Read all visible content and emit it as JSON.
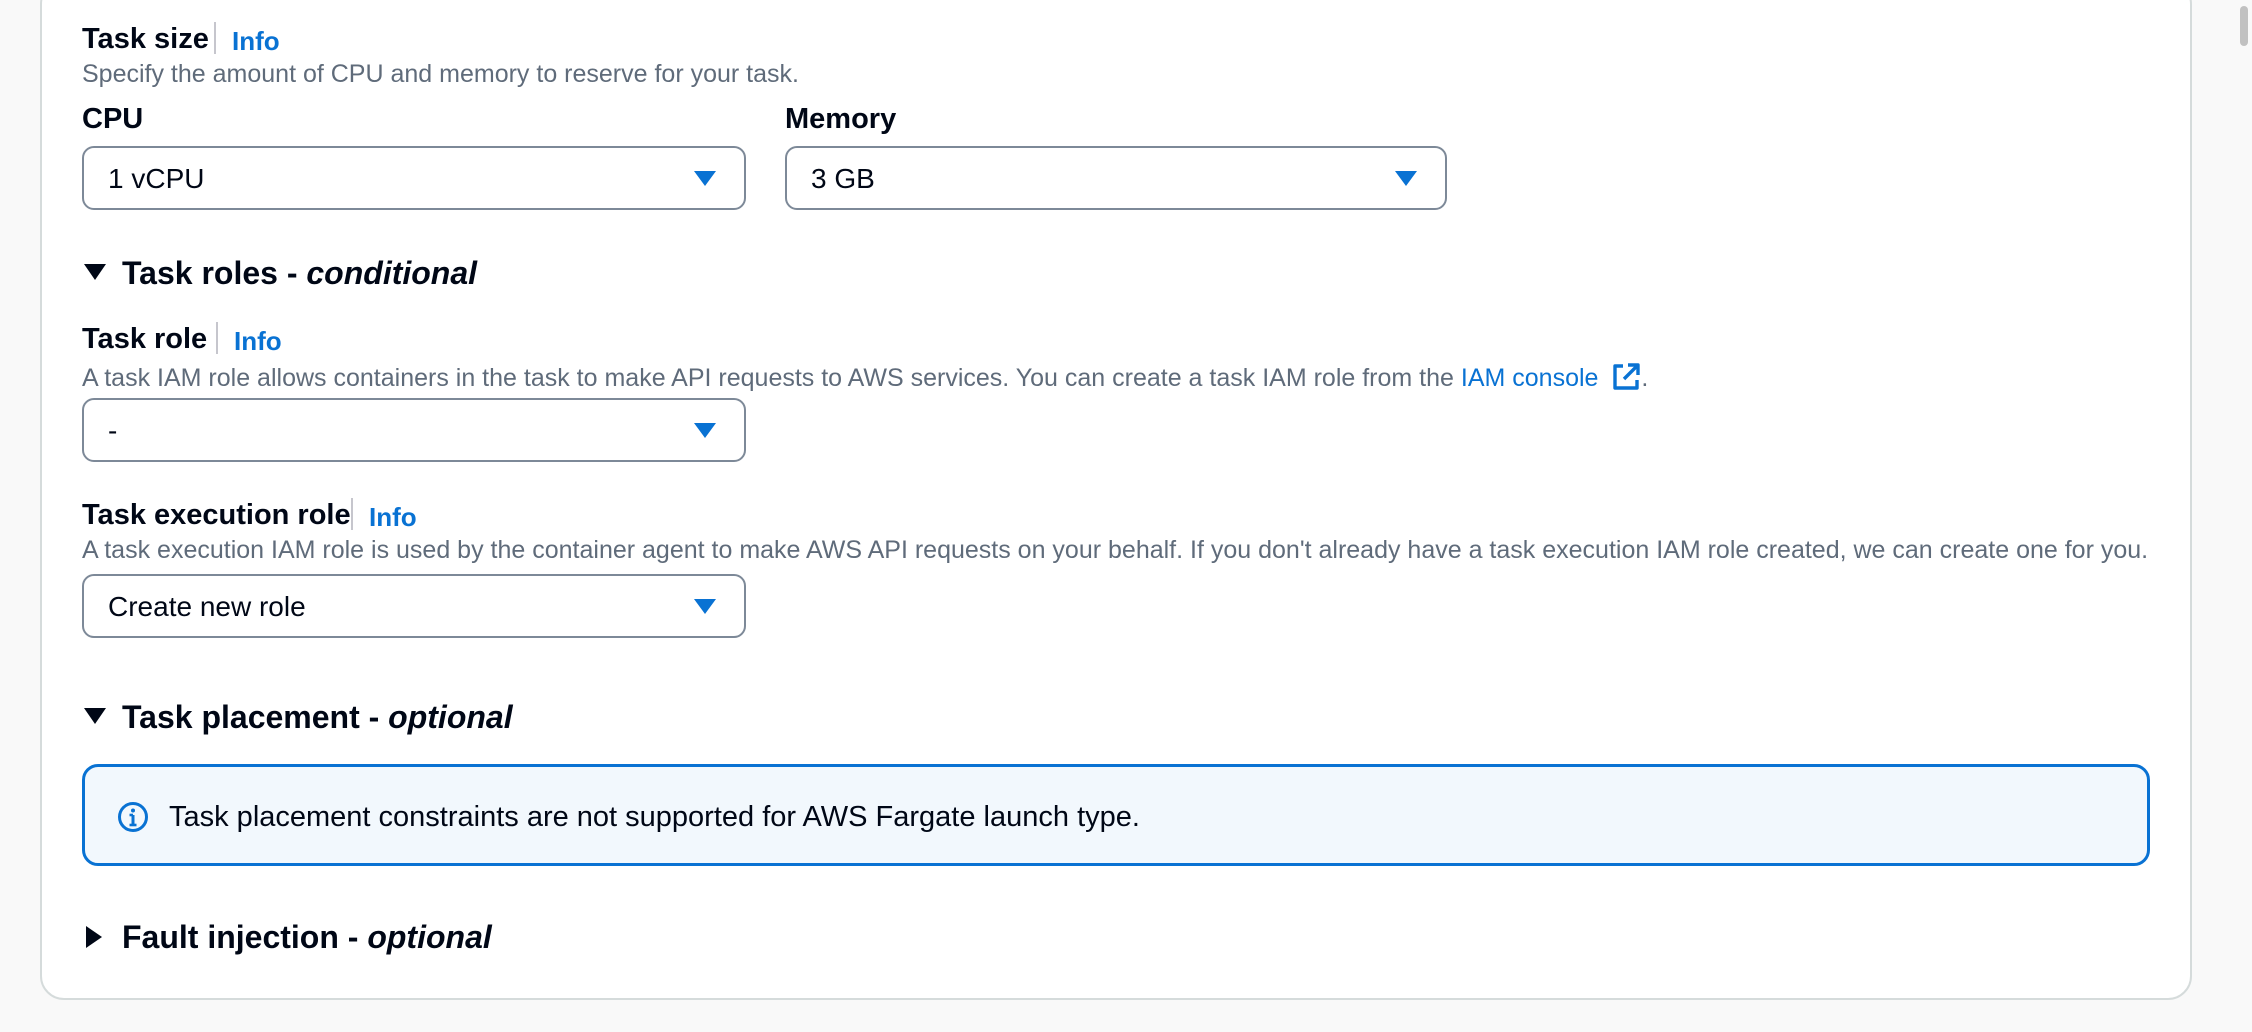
{
  "task_size": {
    "label": "Task size",
    "info": "Info",
    "description": "Specify the amount of CPU and memory to reserve for your task.",
    "cpu": {
      "label": "CPU",
      "value": "1 vCPU"
    },
    "memory": {
      "label": "Memory",
      "value": "3 GB"
    }
  },
  "task_roles": {
    "title": "Task roles - ",
    "suffix": "conditional",
    "expanded": true,
    "task_role": {
      "label": "Task role",
      "info": "Info",
      "description": "A task IAM role allows containers in the task to make API requests to AWS services. You can create a task IAM role from the ",
      "link": "IAM console",
      "description_end": ".",
      "value": "-"
    },
    "execution_role": {
      "label": "Task execution role",
      "info": "Info",
      "description": "A task execution IAM role is used by the container agent to make AWS API requests on your behalf. If you don't already have a task execution IAM role created, we can create one for you.",
      "value": "Create new role"
    }
  },
  "task_placement": {
    "title": "Task placement - ",
    "suffix": "optional",
    "expanded": true,
    "alert": "Task placement constraints are not supported for AWS Fargate launch type."
  },
  "fault_injection": {
    "title": "Fault injection - ",
    "suffix": "optional",
    "expanded": false
  },
  "colors": {
    "accent": "#0972d3",
    "text": "#000716",
    "muted": "#5f6b7a",
    "alert_bg": "#f2f8fd"
  },
  "icons": {
    "external_link": "external-link-icon",
    "info_circle": "info-circle-icon",
    "caret_down": "caret-down-icon",
    "expand_down": "triangle-down-icon",
    "expand_right": "triangle-right-icon"
  }
}
